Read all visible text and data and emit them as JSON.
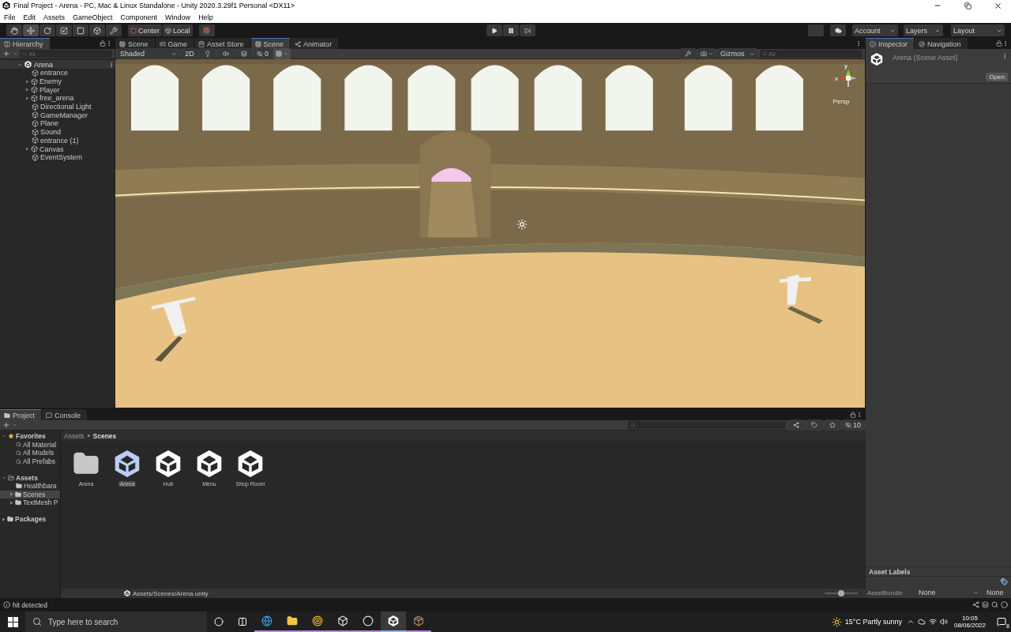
{
  "window": {
    "title": "Final Project - Arena - PC, Mac & Linux Standalone - Unity 2020.3.29f1 Personal <DX11>"
  },
  "menu": [
    "File",
    "Edit",
    "Assets",
    "GameObject",
    "Component",
    "Window",
    "Help"
  ],
  "toolbar": {
    "tools": [
      {
        "kind": "hand",
        "selected": false
      },
      {
        "kind": "move",
        "selected": true
      },
      {
        "kind": "rotate",
        "selected": false
      },
      {
        "kind": "scale",
        "selected": false
      },
      {
        "kind": "rect",
        "selected": false
      },
      {
        "kind": "transform",
        "selected": false
      },
      {
        "kind": "custom",
        "selected": false
      }
    ],
    "pivot": "Center",
    "space": "Local",
    "account": "Account",
    "layers": "Layers",
    "layout": "Layout"
  },
  "hierarchy": {
    "tab": "Hierarchy",
    "search": {
      "placeholder": "All"
    },
    "root": {
      "label": "Arena",
      "expanded": true,
      "children": [
        {
          "label": "entrance",
          "expandable": false
        },
        {
          "label": "Enemy",
          "expandable": true
        },
        {
          "label": "Player",
          "expandable": true
        },
        {
          "label": "free_arena",
          "expandable": true
        },
        {
          "label": "Directional Light",
          "expandable": false
        },
        {
          "label": "GameManager",
          "expandable": false
        },
        {
          "label": "Plane",
          "expandable": false
        },
        {
          "label": "Sound",
          "expandable": false
        },
        {
          "label": "entrance (1)",
          "expandable": false
        },
        {
          "label": "Canvas",
          "expandable": true
        },
        {
          "label": "EventSystem",
          "expandable": false
        }
      ]
    }
  },
  "scene_tabs": [
    {
      "label": "Scene",
      "kind": "scene",
      "selected": false
    },
    {
      "label": "Game",
      "kind": "game",
      "selected": false
    },
    {
      "label": "Asset Store",
      "kind": "store",
      "selected": false
    },
    {
      "label": "Scene",
      "kind": "scene",
      "selected": true
    },
    {
      "label": "Animator",
      "kind": "animator",
      "selected": false
    }
  ],
  "scene_toolbar": {
    "shading": "Shaded",
    "mode_2d": "2D",
    "hidden_count": "0",
    "grid": {
      "on": true
    },
    "gizmos": "Gizmos",
    "search": {
      "placeholder": "All"
    }
  },
  "scene_view": {
    "kind": "picture",
    "axis_y": "y",
    "axis_x": "x",
    "projection": "Persp"
  },
  "inspector": {
    "tabs": [
      {
        "label": "Inspector",
        "selected": true
      },
      {
        "label": "Navigation",
        "selected": false
      }
    ],
    "asset": "Arena (Scene Asset)",
    "open_button": "Open",
    "labels_heading": "Asset Labels",
    "bundle_label": "AssetBundle",
    "bundle": "None",
    "variant": "None"
  },
  "project": {
    "tabs": [
      {
        "label": "Project",
        "selected": true
      },
      {
        "label": "Console",
        "selected": false
      }
    ],
    "hidden_count": "10",
    "sidebar": [
      {
        "label": "Favorites",
        "kind": "favorites",
        "expanded": true,
        "selected": false,
        "children": [
          {
            "label": "All Material",
            "kind": "search",
            "selected": false
          },
          {
            "label": "All Models",
            "kind": "search",
            "selected": false
          },
          {
            "label": "All Prefabs",
            "kind": "search",
            "selected": false
          }
        ]
      },
      {
        "label": "Assets",
        "kind": "folder",
        "expanded": true,
        "selected": false,
        "children": [
          {
            "label": "Healthbara",
            "kind": "folder",
            "selected": false
          },
          {
            "label": "Scenes",
            "kind": "folder",
            "expanded": false,
            "selected": true
          },
          {
            "label": "TextMesh P",
            "kind": "folder",
            "expanded": false,
            "selected": false
          }
        ]
      },
      {
        "label": "Packages",
        "kind": "folder",
        "expanded": false,
        "selected": false
      }
    ],
    "breadcrumb": [
      "Assets",
      "Scenes"
    ],
    "assets": [
      {
        "label": "Arena",
        "kind": "folder",
        "selected": false
      },
      {
        "label": "Arena",
        "kind": "scene",
        "selected": true
      },
      {
        "label": "Hub",
        "kind": "scene",
        "selected": false
      },
      {
        "label": "Menu",
        "kind": "scene",
        "selected": false
      },
      {
        "label": "Shop Room",
        "kind": "scene",
        "selected": false
      }
    ],
    "path": "Assets/Scenes/Arena.unity",
    "zoom": {
      "level": 0.5
    }
  },
  "status_bar": "hit detected",
  "taskbar": {
    "search": {
      "placeholder": "Type here to search"
    },
    "apps": [
      {
        "kind": "edge",
        "selected": false
      },
      {
        "kind": "explorer",
        "selected": false
      },
      {
        "kind": "chrome",
        "selected": false
      },
      {
        "kind": "cube",
        "selected": false
      },
      {
        "kind": "ring",
        "selected": false
      },
      {
        "kind": "unity",
        "selected": true
      },
      {
        "kind": "crate",
        "selected": false
      }
    ],
    "weather": "15°C Partly sunny",
    "time": "10:05",
    "date": "08/06/2022",
    "notifications": "8"
  }
}
